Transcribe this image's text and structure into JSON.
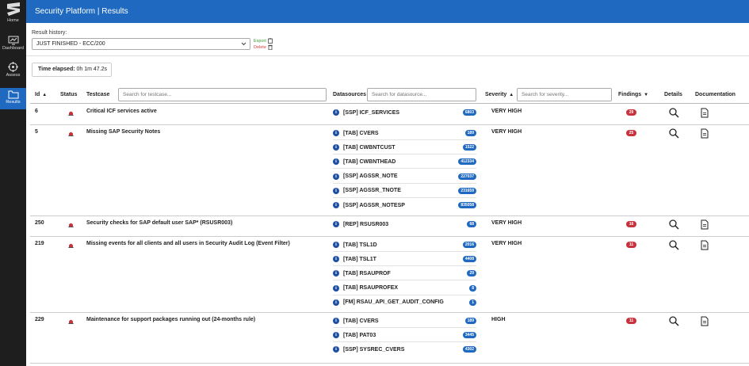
{
  "sidebar": {
    "items": [
      {
        "label": "Home",
        "icon": "home-logo-icon"
      },
      {
        "label": "Dashboard",
        "icon": "monitor-icon"
      },
      {
        "label": "Assess",
        "icon": "crosshair-icon"
      },
      {
        "label": "Results",
        "icon": "folder-icon",
        "active": true
      }
    ]
  },
  "header": {
    "title": "Security Platform | Results"
  },
  "history": {
    "label": "Result history:",
    "selected": "JUST FINISHED - ECC/200",
    "export_label": "Export",
    "delete_label": "Delete"
  },
  "elapsed": {
    "label": "Time elapsed:",
    "value": "0h 1m 47.2s"
  },
  "table": {
    "headers": {
      "id": "Id",
      "status": "Status",
      "testcase": "Testcase",
      "datasources": "Datasources",
      "severity": "Severity",
      "findings": "Findings",
      "details": "Details",
      "documentation": "Documentation"
    },
    "placeholders": {
      "testcase": "Search for testcase...",
      "datasource": "Search for datasource...",
      "severity": "Search for severity..."
    },
    "rows": [
      {
        "id": "6",
        "testcase": "Critical ICF services active",
        "severity": "VERY HIGH",
        "findings": "29",
        "datasources": [
          {
            "name": "[SSP] ICF_SERVICES",
            "count": "6803"
          }
        ]
      },
      {
        "id": "5",
        "testcase": "Missing SAP Security Notes",
        "severity": "VERY HIGH",
        "findings": "25",
        "datasources": [
          {
            "name": "[TAB] CVERS",
            "count": "189"
          },
          {
            "name": "[TAB] CWBNTCUST",
            "count": "1522"
          },
          {
            "name": "[TAB] CWBNTHEAD",
            "count": "412334"
          },
          {
            "name": "[SSP] AGSSR_NOTE",
            "count": "227037"
          },
          {
            "name": "[SSP] AGSSR_TNOTE",
            "count": "231659"
          },
          {
            "name": "[SSP] AGSSR_NOTESP",
            "count": "835058"
          }
        ]
      },
      {
        "id": "250",
        "testcase": "Security checks for SAP default user SAP* (RSUSR003)",
        "severity": "VERY HIGH",
        "findings": "16",
        "datasources": [
          {
            "name": "[REP] RSUSR003",
            "count": "68"
          }
        ]
      },
      {
        "id": "219",
        "testcase": "Missing events for all clients and all users in Security Audit Log (Event Filter)",
        "severity": "VERY HIGH",
        "findings": "11",
        "datasources": [
          {
            "name": "[TAB] TSL1D",
            "count": "2016"
          },
          {
            "name": "[TAB] TSL1T",
            "count": "4408"
          },
          {
            "name": "[TAB] RSAUPROF",
            "count": "29"
          },
          {
            "name": "[TAB] RSAUPROFEX",
            "count": "8"
          },
          {
            "name": "[FM] RSAU_API_GET_AUDIT_CONFIG",
            "count": "1"
          }
        ]
      },
      {
        "id": "229",
        "testcase": "Maintenance for support packages running out (24-months rule)",
        "severity": "HIGH",
        "findings": "11",
        "datasources": [
          {
            "name": "[TAB] CVERS",
            "count": "189"
          },
          {
            "name": "[TAB] PAT03",
            "count": "3445"
          },
          {
            "name": "[SSP] SYSREC_CVERS",
            "count": "4302"
          }
        ]
      }
    ]
  },
  "colors": {
    "brand": "#1f6ac0",
    "sidebar": "#1e1e1e",
    "finding_badge": "#c8323c",
    "export": "#3a9a3a",
    "delete": "#d04040"
  }
}
